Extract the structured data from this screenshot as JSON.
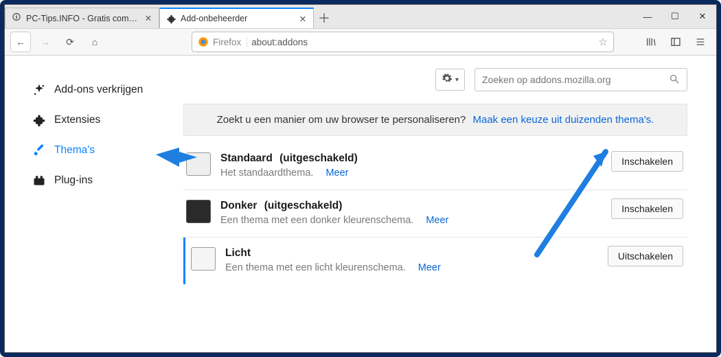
{
  "window": {
    "tabs": [
      {
        "label": "PC-Tips.INFO - Gratis computer tips",
        "active": false
      },
      {
        "label": "Add-onbeheerder",
        "active": true
      }
    ],
    "newtab_tooltip": "Nieuw tabblad",
    "controls": {
      "min": "—",
      "max": "☐",
      "close": "✕"
    }
  },
  "toolbar": {
    "identity": "Firefox",
    "address": "about:addons"
  },
  "sidebar": {
    "items": [
      {
        "label": "Add-ons verkrijgen"
      },
      {
        "label": "Extensies"
      },
      {
        "label": "Thema's"
      },
      {
        "label": "Plug-ins"
      }
    ],
    "active_index": 2
  },
  "main": {
    "search_placeholder": "Zoeken op addons.mozilla.org",
    "banner_text": "Zoekt u een manier om uw browser te personaliseren?",
    "banner_link": "Maak een keuze uit duizenden thema's.",
    "themes": [
      {
        "name": "Standaard",
        "status": "(uitgeschakeld)",
        "desc": "Het standaardthema.",
        "more": "Meer",
        "button": "Inschakelen",
        "active": false,
        "tone": "std"
      },
      {
        "name": "Donker",
        "status": "(uitgeschakeld)",
        "desc": "Een thema met een donker kleurenschema.",
        "more": "Meer",
        "button": "Inschakelen",
        "active": false,
        "tone": "dark"
      },
      {
        "name": "Licht",
        "status": "",
        "desc": "Een thema met een licht kleurenschema.",
        "more": "Meer",
        "button": "Uitschakelen",
        "active": true,
        "tone": "light"
      }
    ]
  }
}
